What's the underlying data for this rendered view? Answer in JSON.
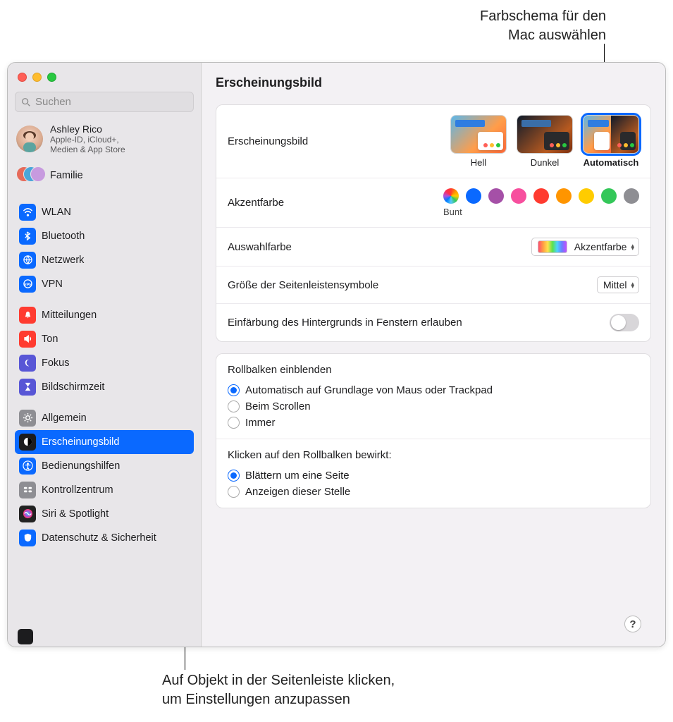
{
  "annotations": {
    "top": "Farbschema für den\nMac auswählen",
    "bottom": "Auf Objekt in der Seitenleiste klicken,\num Einstellungen anzupassen"
  },
  "search": {
    "placeholder": "Suchen"
  },
  "account": {
    "name": "Ashley Rico",
    "subline1": "Apple-ID, iCloud+,",
    "subline2": "Medien & App Store"
  },
  "family": {
    "label": "Familie"
  },
  "sidebar": {
    "groups": [
      [
        {
          "id": "wlan",
          "label": "WLAN",
          "color": "#0a69ff",
          "icon": "wifi"
        },
        {
          "id": "bluetooth",
          "label": "Bluetooth",
          "color": "#0a69ff",
          "icon": "bluetooth"
        },
        {
          "id": "netzwerk",
          "label": "Netzwerk",
          "color": "#0a69ff",
          "icon": "globe"
        },
        {
          "id": "vpn",
          "label": "VPN",
          "color": "#0a69ff",
          "icon": "vpn"
        }
      ],
      [
        {
          "id": "mitteilungen",
          "label": "Mitteilungen",
          "color": "#ff3b30",
          "icon": "bell"
        },
        {
          "id": "ton",
          "label": "Ton",
          "color": "#ff3b30",
          "icon": "sound"
        },
        {
          "id": "fokus",
          "label": "Fokus",
          "color": "#5856d6",
          "icon": "moon"
        },
        {
          "id": "bildschirmzeit",
          "label": "Bildschirmzeit",
          "color": "#5856d6",
          "icon": "hourglass"
        }
      ],
      [
        {
          "id": "allgemein",
          "label": "Allgemein",
          "color": "#8e8e93",
          "icon": "gear"
        },
        {
          "id": "erscheinungsbild",
          "label": "Erscheinungsbild",
          "color": "#1c1c1e",
          "icon": "appearance",
          "selected": true
        },
        {
          "id": "bedienungshilfen",
          "label": "Bedienungshilfen",
          "color": "#0a69ff",
          "icon": "accessibility"
        },
        {
          "id": "kontrollzentrum",
          "label": "Kontrollzentrum",
          "color": "#8e8e93",
          "icon": "control"
        },
        {
          "id": "siri",
          "label": "Siri & Spotlight",
          "color": "#222",
          "icon": "siri"
        },
        {
          "id": "datenschutz",
          "label": "Datenschutz & Sicherheit",
          "color": "#0a69ff",
          "icon": "privacy"
        }
      ]
    ]
  },
  "main": {
    "title": "Erscheinungsbild",
    "appearance": {
      "label": "Erscheinungsbild",
      "options": [
        {
          "label": "Hell",
          "mode": "light"
        },
        {
          "label": "Dunkel",
          "mode": "dark"
        },
        {
          "label": "Automatisch",
          "mode": "auto",
          "selected": true
        }
      ]
    },
    "accent": {
      "label": "Akzentfarbe",
      "caption": "Bunt",
      "colors": [
        "multi",
        "#0a69ff",
        "#a550a7",
        "#f74f9e",
        "#ff3b30",
        "#ff9500",
        "#ffcc00",
        "#34c759",
        "#8e8e93"
      ]
    },
    "highlight": {
      "label": "Auswahlfarbe",
      "value": "Akzentfarbe"
    },
    "sidebar_icon_size": {
      "label": "Größe der Seitenleistensymbole",
      "value": "Mittel"
    },
    "wallpaper_tint": {
      "label": "Einfärbung des Hintergrunds in Fenstern erlauben",
      "on": false
    },
    "scrollbars": {
      "heading": "Rollbalken einblenden",
      "options": [
        {
          "label": "Automatisch auf Grundlage von Maus oder Trackpad",
          "checked": true
        },
        {
          "label": "Beim Scrollen",
          "checked": false
        },
        {
          "label": "Immer",
          "checked": false
        }
      ]
    },
    "scroll_click": {
      "heading": "Klicken auf den Rollbalken bewirkt:",
      "options": [
        {
          "label": "Blättern um eine Seite",
          "checked": true
        },
        {
          "label": "Anzeigen dieser Stelle",
          "checked": false
        }
      ]
    },
    "help": "?"
  }
}
